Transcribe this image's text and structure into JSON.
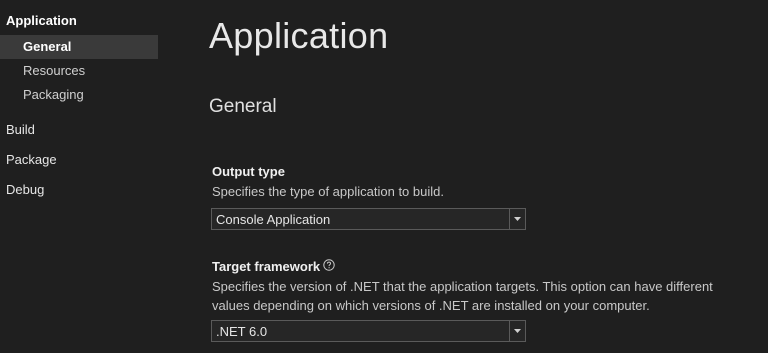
{
  "sidebar": {
    "sections": [
      {
        "label": "Application",
        "active": true,
        "items": [
          "General",
          "Resources",
          "Packaging"
        ]
      },
      {
        "label": "Build"
      },
      {
        "label": "Package"
      },
      {
        "label": "Debug"
      }
    ],
    "selected_item": "General"
  },
  "main": {
    "page_title": "Application",
    "section_title": "General",
    "output_type": {
      "label": "Output type",
      "description": "Specifies the type of application to build.",
      "value": "Console Application"
    },
    "target_framework": {
      "label": "Target framework",
      "description": "Specifies the version of .NET that the application targets. This option can have different values depending on which versions of .NET are installed on your computer.",
      "value": ".NET 6.0"
    }
  },
  "icons": {
    "help": "question-circle-icon",
    "dropdown": "chevron-down-icon"
  },
  "colors": {
    "background": "#1f1f1f",
    "selected_item": "#3a3a3a",
    "border": "#5a5a5a"
  }
}
